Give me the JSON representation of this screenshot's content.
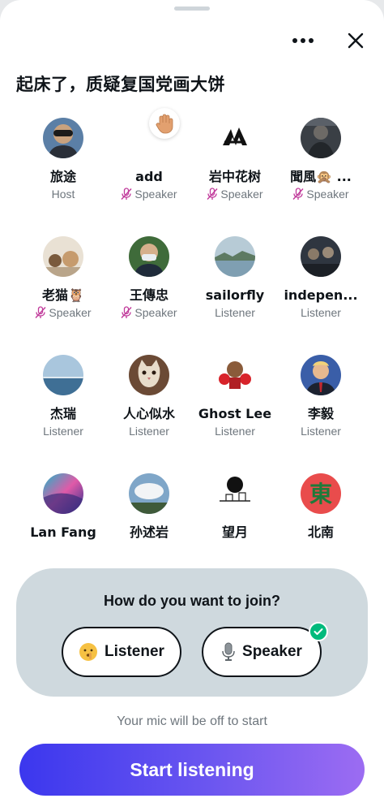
{
  "space": {
    "title": "起床了，质疑复国党画大饼"
  },
  "header": {
    "more_icon": "more-icon",
    "close_icon": "close-icon"
  },
  "participants": [
    {
      "name": "旅途",
      "role": "Host",
      "muted": false,
      "avatar": "person-goggles"
    },
    {
      "name": "add",
      "role": "Speaker",
      "muted": true,
      "avatar": "none",
      "hand_raised": true
    },
    {
      "name": "岩中花树",
      "role": "Speaker",
      "muted": true,
      "avatar": "black-logo"
    },
    {
      "name": "聞風🙊 ...",
      "role": "Speaker",
      "muted": true,
      "avatar": "dark-scene"
    },
    {
      "name": "老猫🦉",
      "role": "Speaker",
      "muted": true,
      "avatar": "toys"
    },
    {
      "name": "王傳忠",
      "role": "Speaker",
      "muted": true,
      "avatar": "masked-man"
    },
    {
      "name": "sailorfly",
      "role": "Listener",
      "muted": false,
      "avatar": "lake"
    },
    {
      "name": "indepen...",
      "role": "Listener",
      "muted": false,
      "avatar": "dark-people"
    },
    {
      "name": "杰瑞",
      "role": "Listener",
      "muted": false,
      "avatar": "sea-sky"
    },
    {
      "name": "人心似水",
      "role": "Listener",
      "muted": false,
      "avatar": "cat"
    },
    {
      "name": "Ghost Lee",
      "role": "Listener",
      "muted": false,
      "avatar": "boxer"
    },
    {
      "name": "李毅",
      "role": "Listener",
      "muted": false,
      "avatar": "suit-man"
    },
    {
      "name": "Lan Fang",
      "role": "",
      "muted": false,
      "avatar": "nebula"
    },
    {
      "name": "孙述岩",
      "role": "",
      "muted": false,
      "avatar": "clouds"
    },
    {
      "name": "望月",
      "role": "",
      "muted": false,
      "avatar": "moon-sketch"
    },
    {
      "name": "北南",
      "role": "",
      "muted": false,
      "avatar": "dong-character"
    }
  ],
  "join": {
    "question": "How do you want to join?",
    "listener_label": "Listener",
    "speaker_label": "Speaker",
    "selected": "Speaker"
  },
  "mic_note": "Your mic will be off to start",
  "start_button": "Start listening",
  "colors": {
    "accent_start": "#3b37ee",
    "accent_end": "#9c6cf2",
    "muted_icon": "#c0399a",
    "check": "#00ba7c",
    "card_bg": "#cfd9de"
  }
}
